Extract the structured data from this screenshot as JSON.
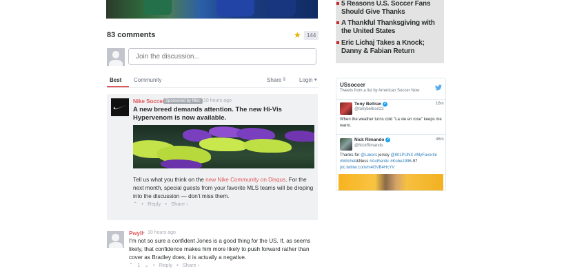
{
  "comments": {
    "count_label": "83 comments",
    "favorites": "144",
    "input_placeholder": "Join the discussion...",
    "tabs": {
      "best": "Best",
      "community": "Community",
      "share": "Share",
      "login": "Login"
    },
    "sponsored": {
      "author": "Nike Soccer",
      "badge": "Sponsored by Nike",
      "time": "10 hours ago",
      "headline": "A new breed demands attention. The new Hi-Vis Hypervenom is now available.",
      "body_before": "Tell us what you think on the ",
      "body_link": "new Nike Community on Disqus",
      "body_after": ". For the next month, special guests from your favorite MLS teams will be droping into the discussion — don't miss them.",
      "reply": "Reply",
      "share": "Share ›"
    },
    "comment": {
      "author": "Pwyll",
      "time": "10 hours ago",
      "body": "I'm not so sure a confident Jones is a good thing for the US. If, as seems likely, that confidence makes him more likely to push forward rather than cover as Bradley does, it is actually a negative.",
      "votes": "1",
      "reply": "Reply",
      "share": "Share ›"
    }
  },
  "sidebar": {
    "articles": [
      "5 Reasons U.S. Soccer Fans Should Give Thanks",
      "A Thankful Thanksgiving with the United States",
      "Eric Lichaj Takes a Knock; Danny & Fabian Return"
    ],
    "twitter": {
      "title": "USsoccer",
      "subtitle": "Tweets from a list by American Soccer Now",
      "tweets": [
        {
          "name": "Tony Beltran",
          "handle": "@tonybeltran23",
          "time": "16m",
          "text": "When the weather turns cold \"La vie en rose\" keeps me warm."
        },
        {
          "name": "Nick Rimando",
          "handle": "@NickRimando",
          "time": "46m",
          "text_line1_a": "Thanks for ",
          "text_line1_link1": "@Lakers",
          "text_line1_b": " jersey ",
          "text_line1_link2": "@801PUNX",
          "text_line1_c": " ",
          "text_line1_link3": "#MyFavorite",
          "text_line2_link1": "#Mitchell",
          "text_line2_a": "&Ness ",
          "text_line2_link2": "#Authentic",
          "text_line2_b": " ",
          "text_line2_link3": "#Kobe1996",
          "text_line2_c": "-97",
          "text_line3": "pic.twitter.com/m4GVB4HcYV"
        }
      ]
    }
  },
  "colors": {
    "accent": "#e0575b",
    "bullet": "#c6282c",
    "link": "#2b7bb9"
  }
}
